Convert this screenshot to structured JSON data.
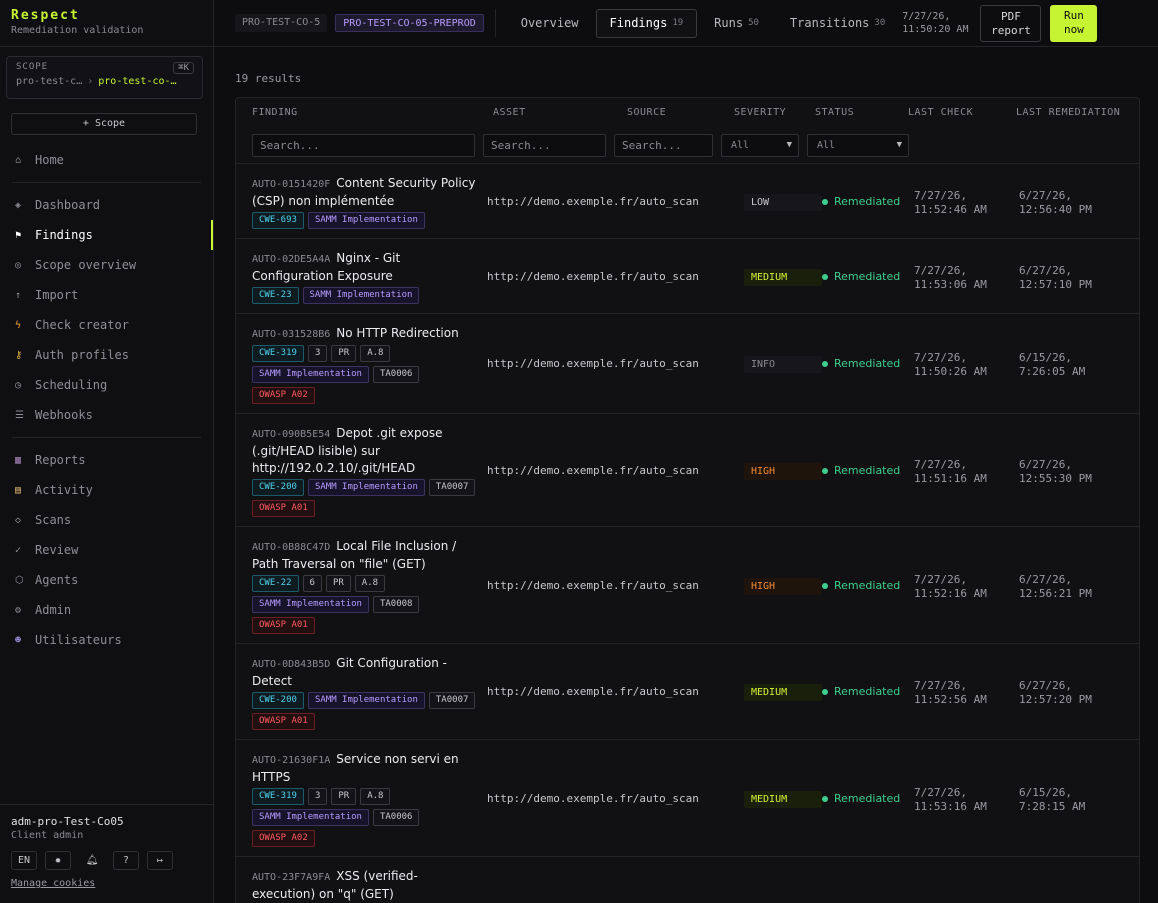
{
  "brand": {
    "title": "Respect",
    "subtitle": "Remediation validation"
  },
  "scope": {
    "label": "SCOPE",
    "shortcut": "⌘K",
    "path_parent": "pro-test-c…",
    "path_current": "pro-test-co-…"
  },
  "add_scope_label": "+ Scope",
  "nav": {
    "home": "Home",
    "dashboard": "Dashboard",
    "findings": "Findings",
    "scope_overview": "Scope overview",
    "import": "Import",
    "check_creator": "Check creator",
    "auth_profiles": "Auth profiles",
    "scheduling": "Scheduling",
    "webhooks": "Webhooks",
    "reports": "Reports",
    "activity": "Activity",
    "scans": "Scans",
    "review": "Review",
    "agents": "Agents",
    "admin": "Admin",
    "utilisateurs": "Utilisateurs"
  },
  "user": {
    "name": "adm-pro-Test-Co05",
    "role": "Client admin",
    "lang": "EN",
    "manage_cookies": "Manage cookies"
  },
  "topbar": {
    "chip_parent": "PRO-TEST-CO-5",
    "chip_current": "PRO-TEST-CO-05-PREPROD",
    "tabs": [
      {
        "label": "Overview",
        "count": ""
      },
      {
        "label": "Findings",
        "count": "19"
      },
      {
        "label": "Runs",
        "count": "50"
      },
      {
        "label": "Transitions",
        "count": "30"
      }
    ],
    "timestamp_date": "7/27/26,",
    "timestamp_time": "11:50:20 AM",
    "pdf_line1": "PDF",
    "pdf_line2": "report",
    "run_line1": "Run",
    "run_line2": "now"
  },
  "results_count": "19 results",
  "table": {
    "headers": {
      "finding": "FINDING",
      "asset": "ASSET",
      "source": "SOURCE",
      "severity": "SEVERITY",
      "status": "STATUS",
      "last_check": "LAST CHECK",
      "last_remediation": "LAST REMEDIATION"
    },
    "filters": {
      "search_placeholder": "Search...",
      "select_all": "All"
    },
    "rows": [
      {
        "id": "AUTO-0151420F",
        "title": "Content Security Policy (CSP) non implémentée",
        "tags": [
          "CWE-693",
          "SAMM Implementation"
        ],
        "asset": "http://demo.exemple.fr/auto_scan",
        "severity": "LOW",
        "status": "Remediated",
        "check_date": "7/27/26,",
        "check_time": "11:52:46 AM",
        "rem_date": "6/27/26,",
        "rem_time": "12:56:40 PM"
      },
      {
        "id": "AUTO-02DE5A4A",
        "title": "Nginx - Git Configuration Exposure",
        "tags": [
          "CWE-23",
          "SAMM Implementation"
        ],
        "asset": "http://demo.exemple.fr/auto_scan",
        "severity": "MEDIUM",
        "status": "Remediated",
        "check_date": "7/27/26,",
        "check_time": "11:53:06 AM",
        "rem_date": "6/27/26,",
        "rem_time": "12:57:10 PM"
      },
      {
        "id": "AUTO-031528B6",
        "title": "No HTTP Redirection",
        "tags": [
          "CWE-319",
          "3",
          "PR",
          "A.8",
          "SAMM Implementation",
          "TA0006",
          "OWASP A02"
        ],
        "asset": "http://demo.exemple.fr/auto_scan",
        "severity": "INFO",
        "status": "Remediated",
        "check_date": "7/27/26,",
        "check_time": "11:50:26 AM",
        "rem_date": "6/15/26,",
        "rem_time": "7:26:05 AM"
      },
      {
        "id": "AUTO-090B5E54",
        "title": "Depot .git expose (.git/HEAD lisible) sur http://192.0.2.10/.git/HEAD",
        "tags": [
          "CWE-200",
          "SAMM Implementation",
          "TA0007",
          "OWASP A01"
        ],
        "asset": "http://demo.exemple.fr/auto_scan",
        "severity": "HIGH",
        "status": "Remediated",
        "check_date": "7/27/26,",
        "check_time": "11:51:16 AM",
        "rem_date": "6/27/26,",
        "rem_time": "12:55:30 PM"
      },
      {
        "id": "AUTO-0B88C47D",
        "title": "Local File Inclusion / Path Traversal on \"file\" (GET)",
        "tags": [
          "CWE-22",
          "6",
          "PR",
          "A.8",
          "SAMM Implementation",
          "TA0008",
          "OWASP A01"
        ],
        "asset": "http://demo.exemple.fr/auto_scan",
        "severity": "HIGH",
        "status": "Remediated",
        "check_date": "7/27/26,",
        "check_time": "11:52:16 AM",
        "rem_date": "6/27/26,",
        "rem_time": "12:56:21 PM"
      },
      {
        "id": "AUTO-0D843B5D",
        "title": "Git Configuration - Detect",
        "tags": [
          "CWE-200",
          "SAMM Implementation",
          "TA0007",
          "OWASP A01"
        ],
        "asset": "http://demo.exemple.fr/auto_scan",
        "severity": "MEDIUM",
        "status": "Remediated",
        "check_date": "7/27/26,",
        "check_time": "11:52:56 AM",
        "rem_date": "6/27/26,",
        "rem_time": "12:57:20 PM"
      },
      {
        "id": "AUTO-21630F1A",
        "title": "Service non servi en HTTPS",
        "tags": [
          "CWE-319",
          "3",
          "PR",
          "A.8",
          "SAMM Implementation",
          "TA0006",
          "OWASP A02"
        ],
        "asset": "http://demo.exemple.fr/auto_scan",
        "severity": "MEDIUM",
        "status": "Remediated",
        "check_date": "7/27/26,",
        "check_time": "11:53:16 AM",
        "rem_date": "6/15/26,",
        "rem_time": "7:28:15 AM"
      },
      {
        "id": "AUTO-23F7A9FA",
        "title": "XSS (verified-execution) on \"q\" (GET)",
        "tags": [],
        "asset": "",
        "severity": "",
        "status": "",
        "check_date": "",
        "check_time": "",
        "rem_date": "",
        "rem_time": ""
      }
    ]
  },
  "colors": {
    "accent": "#c6f432",
    "remediated": "#3ecf8e",
    "high": "#f08a32",
    "medium": "#d6f234"
  }
}
